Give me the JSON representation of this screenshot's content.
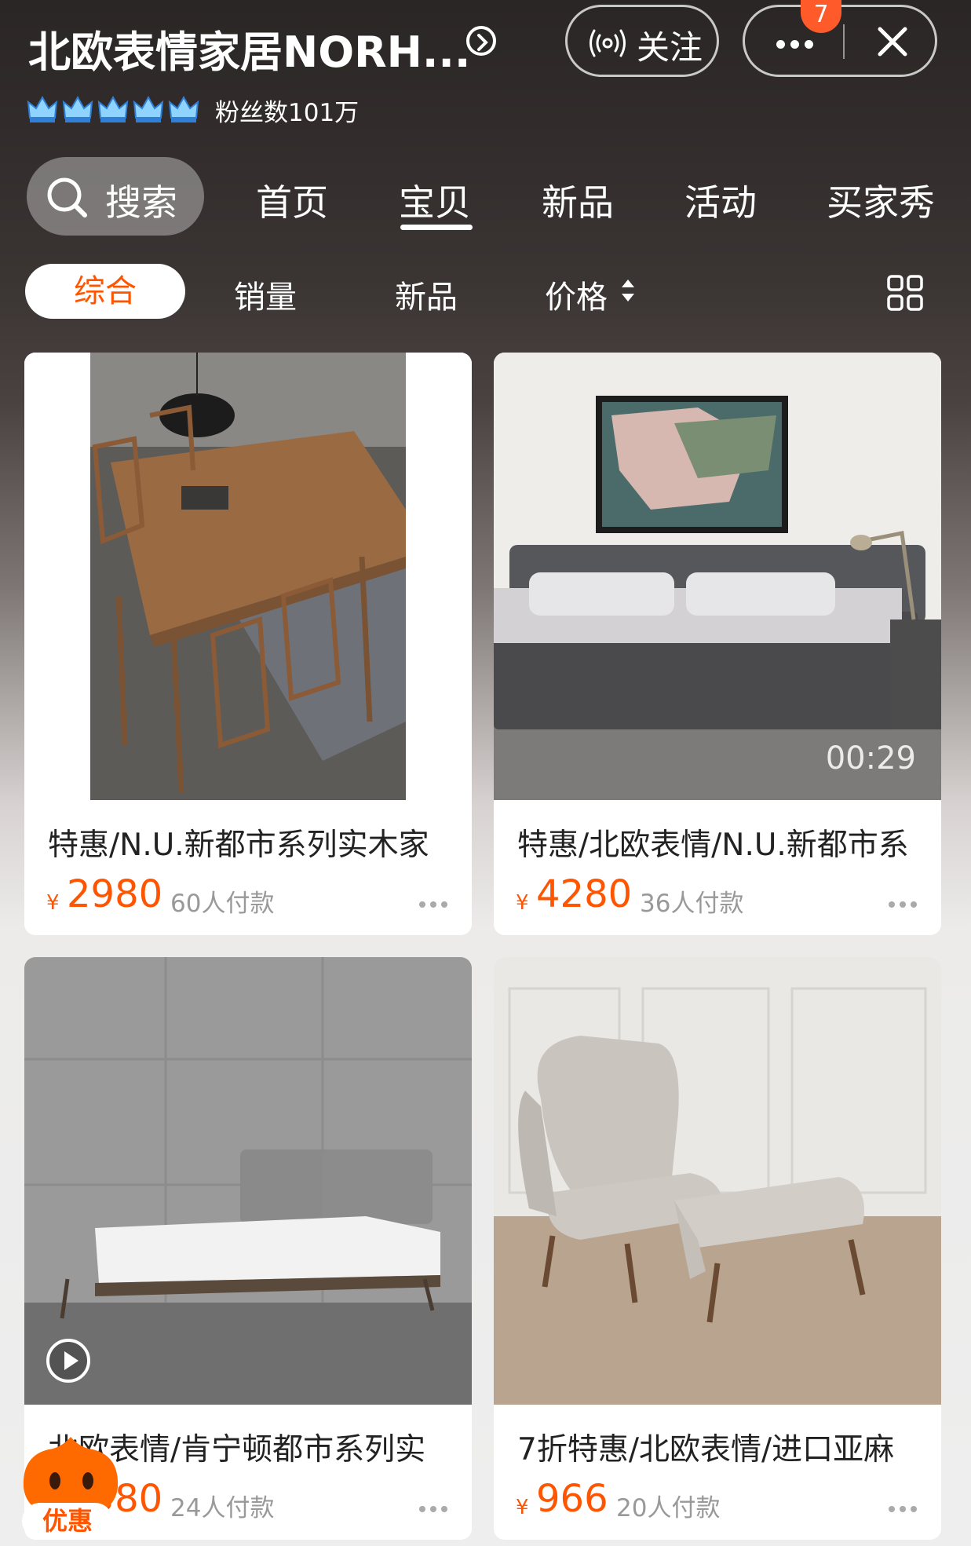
{
  "header": {
    "shop_name": "北欧表情家居NORH...",
    "follow_label": "关注",
    "badge_count": "7",
    "fans_label": "粉丝数101万",
    "crown_count": 5
  },
  "nav": {
    "search_label": "搜索",
    "tabs": [
      "首页",
      "宝贝",
      "新品",
      "活动",
      "买家秀"
    ],
    "active_tab": "宝贝"
  },
  "sort": {
    "items": [
      "综合",
      "销量",
      "新品",
      "价格"
    ],
    "active": "综合"
  },
  "products": [
    {
      "title": "特惠/N.U.新都市系列实木家",
      "currency": "¥",
      "price": "2980",
      "sales": "60人付款"
    },
    {
      "title": "特惠/北欧表情/N.U.新都市系",
      "currency": "¥",
      "price": "4280",
      "sales": "36人付款",
      "video_time": "00:29"
    },
    {
      "title": "北欧表情/肯宁顿都市系列实",
      "currency": "¥",
      "price": "3580",
      "sales": "24人付款"
    },
    {
      "title": "7折特惠/北欧表情/进口亚麻",
      "currency": "¥",
      "price": "966",
      "sales": "20人付款"
    }
  ],
  "promo": {
    "label": "优惠"
  },
  "colors": {
    "accent": "#ff5500",
    "badge": "#ff5a2a"
  }
}
